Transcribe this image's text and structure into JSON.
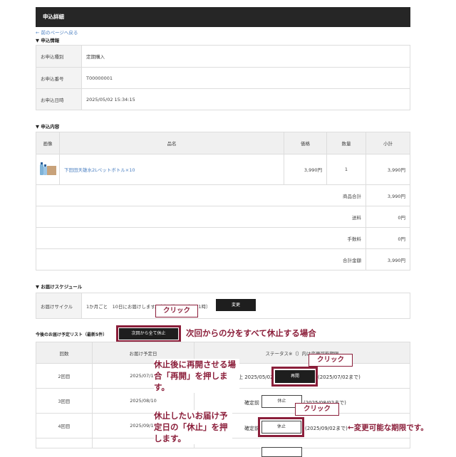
{
  "header": {
    "title": "申込詳細"
  },
  "back_link": "← 前のページへ戻る",
  "application_info": {
    "section_title": "▼ 申込情報",
    "rows": [
      {
        "label": "お申込種別",
        "value": "定期購入"
      },
      {
        "label": "お申込番号",
        "value": "T00000001"
      },
      {
        "label": "お申込日時",
        "value": "2025/05/02 15:34:15"
      }
    ]
  },
  "order_contents": {
    "section_title": "▼ 申込内容",
    "columns": [
      "画像",
      "品名",
      "価格",
      "数量",
      "小計"
    ],
    "item": {
      "name": "下田田天雄水2Lペットボトル×10",
      "price": "3,990円",
      "qty": "1",
      "subtotal": "3,990円"
    },
    "totals": [
      {
        "label": "商品合計",
        "value": "3,990円"
      },
      {
        "label": "送料",
        "value": "0円"
      },
      {
        "label": "手数料",
        "value": "0円"
      },
      {
        "label": "合計金額",
        "value": "3,990円"
      }
    ]
  },
  "delivery_schedule": {
    "section_title": "▼ お届けスケジュール",
    "cycle_label": "お届けサイクル",
    "cycle_value": "1か月ごと　10日にお届けします。（時間帯：19時～21時）",
    "change_button": "変更"
  },
  "upcoming": {
    "title": "今後のお届け予定リスト（最新5件）",
    "suspend_all_button": "次回から全て休止",
    "columns": [
      "回数",
      "お届け予定日",
      "ステータス※（）内は変更可能期限"
    ],
    "rows": [
      {
        "count": "2回目",
        "date": "2025/07/10",
        "status": "休止 2025/05/02",
        "button": "再開",
        "deadline": "(2025/07/02まで)"
      },
      {
        "count": "3回目",
        "date": "2025/08/10",
        "status": "確定前",
        "button": "休止",
        "deadline": "(2025/08/02まで)"
      },
      {
        "count": "4回目",
        "date": "2025/09/10",
        "status": "確定前",
        "button": "休止",
        "deadline": "(2025/09/02まで)"
      }
    ]
  },
  "annotations": {
    "click": "クリック",
    "suspend_all_note": "次回からの分をすべて休止する場合",
    "resume_note": "休止後に再開させる場合「再開」を押します。",
    "suspend_note": "休止したいお届け予定日の「休止」を押します。",
    "deadline_note": "←変更可能な期限です。"
  },
  "colors": {
    "header_bg": "#262626",
    "accent": "#8b1e3a",
    "link": "#4a7fc1"
  }
}
